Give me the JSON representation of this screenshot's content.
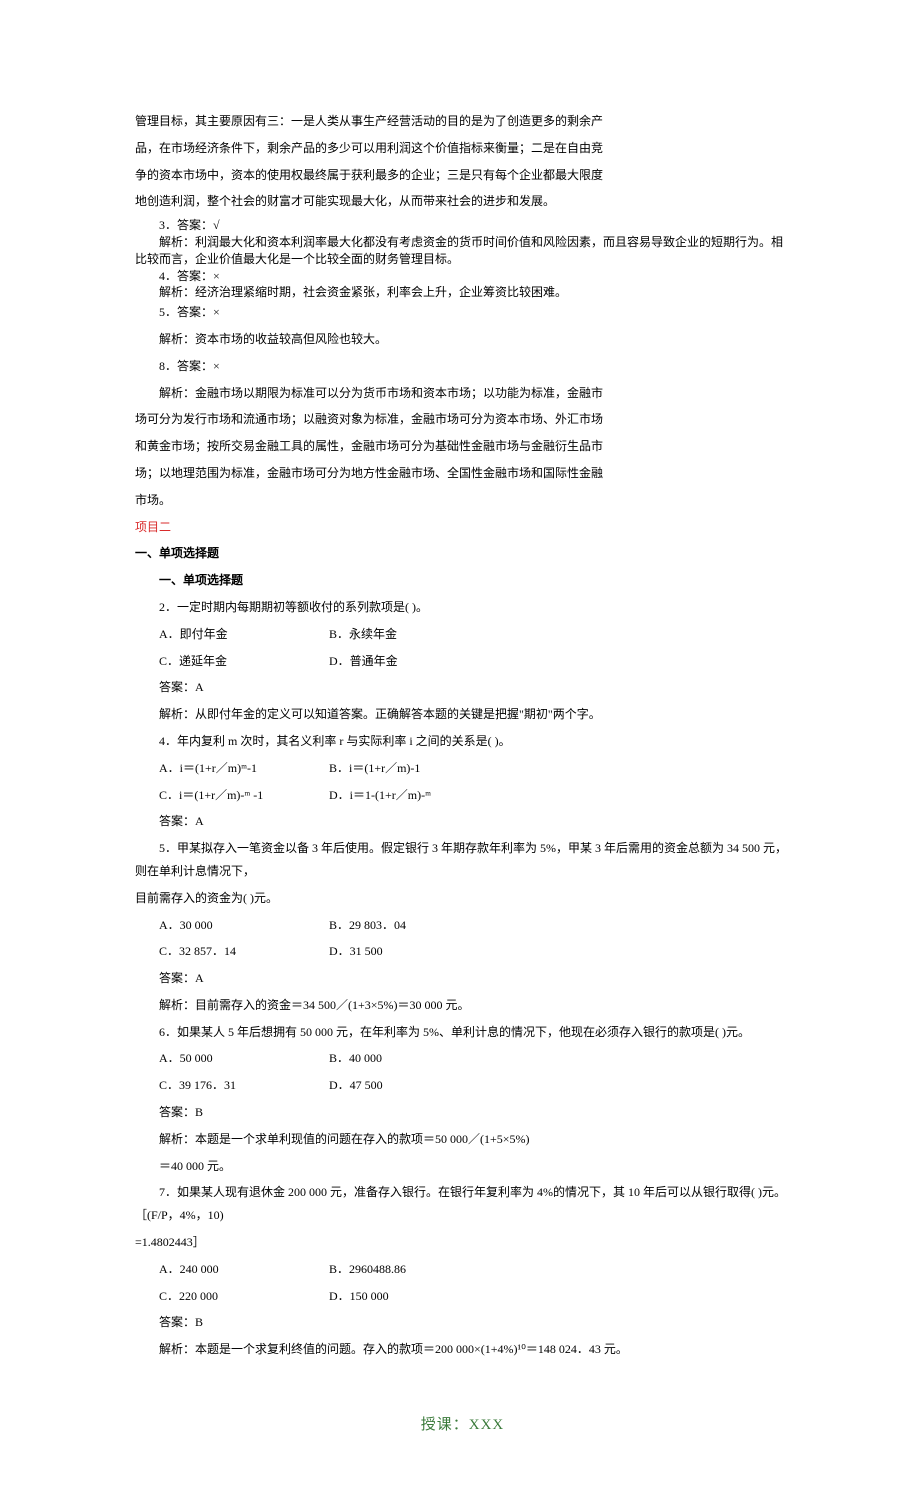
{
  "intro": {
    "p1": "管理目标，其主要原因有三：一是人类从事生产经营活动的目的是为了创造更多的剩余产",
    "p2": "品，在市场经济条件下，剩余产品的多少可以用利润这个价值指标来衡量；二是在自由竞",
    "p3": "争的资本市场中，资本的使用权最终属于获利最多的企业；三是只有每个企业都最大限度",
    "p4": "地创造利润，整个社会的财富才可能实现最大化，从而带来社会的进步和发展。"
  },
  "ans3": {
    "label": "3．答案：√",
    "ex1": "解析：利润最大化和资本利润率最大化都没有考虑资金的货币时间价值和风险因素，而且容易导致企业的短期行为。相比较而言，企业价值最大化是一个比较全面的财务管理目标。"
  },
  "ans4": {
    "label": "4．答案：×",
    "ex": "解析：经济治理紧缩时期，社会资金紧张，利率会上升，企业筹资比较困难。"
  },
  "ans5": {
    "label": "5．答案：×",
    "ex": "解析：资本市场的收益较高但风险也较大。"
  },
  "ans8": {
    "label": "8．答案：×",
    "ex1": "解析：金融市场以期限为标准可以分为货币市场和资本市场；以功能为标准，金融市",
    "ex2": "场可分为发行市场和流通市场；以融资对象为标准，金融市场可分为资本市场、外汇市场",
    "ex3": "和黄金市场；按所交易金融工具的属性，金融市场可分为基础性金融市场与金融衍生品市",
    "ex4": "场；以地理范围为标准，金融市场可分为地方性金融市场、全国性金融市场和国际性金融",
    "ex5": "市场。"
  },
  "project2": "项目二",
  "sec1": "一、单项选择题",
  "sec1b": "一、单项选择题",
  "q2": {
    "stem": "2．一定时期内每期期初等额收付的系列款项是(    )。",
    "a": "A．即付年金",
    "b": "B．永续年金",
    "c": "C．递延年金",
    "d": "D．普通年金",
    "ans": "答案：A",
    "ex": "解析：从即付年金的定义可以知道答案。正确解答本题的关键是把握\"期初\"两个字。"
  },
  "q4": {
    "stem": "4．年内复利 m 次时，其名义利率 r 与实际利率 i 之间的关系是(    )。",
    "a": "A．i＝(1+r／m)ᵐ-1",
    "b": "B．i＝(1+r／m)-1",
    "c": "C．i＝(1+r／m)-ᵐ -1",
    "d": "D．i＝1-(1+r／m)-ᵐ",
    "ans": "答案：A"
  },
  "q5": {
    "stem1": "5．甲某拟存入一笔资金以备 3 年后使用。假定银行 3 年期存款年利率为 5%，甲某 3 年后需用的资金总额为 34 500 元，则在单利计息情况下，",
    "stem2": "目前需存入的资金为(    )元。",
    "a": "A．30 000",
    "b": "B．29 803．04",
    "c": "C．32 857．14",
    "d": "D．31 500",
    "ans": "答案：A",
    "ex": "解析：目前需存入的资金＝34 500／(1+3×5%)＝30 000 元。"
  },
  "q6": {
    "stem": "6．如果某人 5 年后想拥有 50 000 元，在年利率为 5%、单利计息的情况下，他现在必须存入银行的款项是(    )元。",
    "a": "A．50 000",
    "b": "B．40 000",
    "c": "C．39 176．31",
    "d": "D．47 500",
    "ans": "答案：B",
    "ex1": "解析：本题是一个求单利现值的问题在存入的款项＝50 000／(1+5×5%)",
    "ex2": "＝40 000 元。"
  },
  "q7": {
    "stem1": "7．如果某人现有退休金 200 000 元，准备存入银行。在银行年复利率为 4%的情况下，其 10 年后可以从银行取得(    )元。［(F/P，4%，10)",
    "stem2": "=1.4802443］",
    "a": "A．240 000",
    "b": "B．2960488.86",
    "c": "C．220 000",
    "d": "D．150 000",
    "ans": "答案：B",
    "ex": "解析：本题是一个求复利终值的问题。存入的款项＝200 000×(1+4%)¹⁰＝148 024．43 元。"
  },
  "footer": "授课：XXX"
}
